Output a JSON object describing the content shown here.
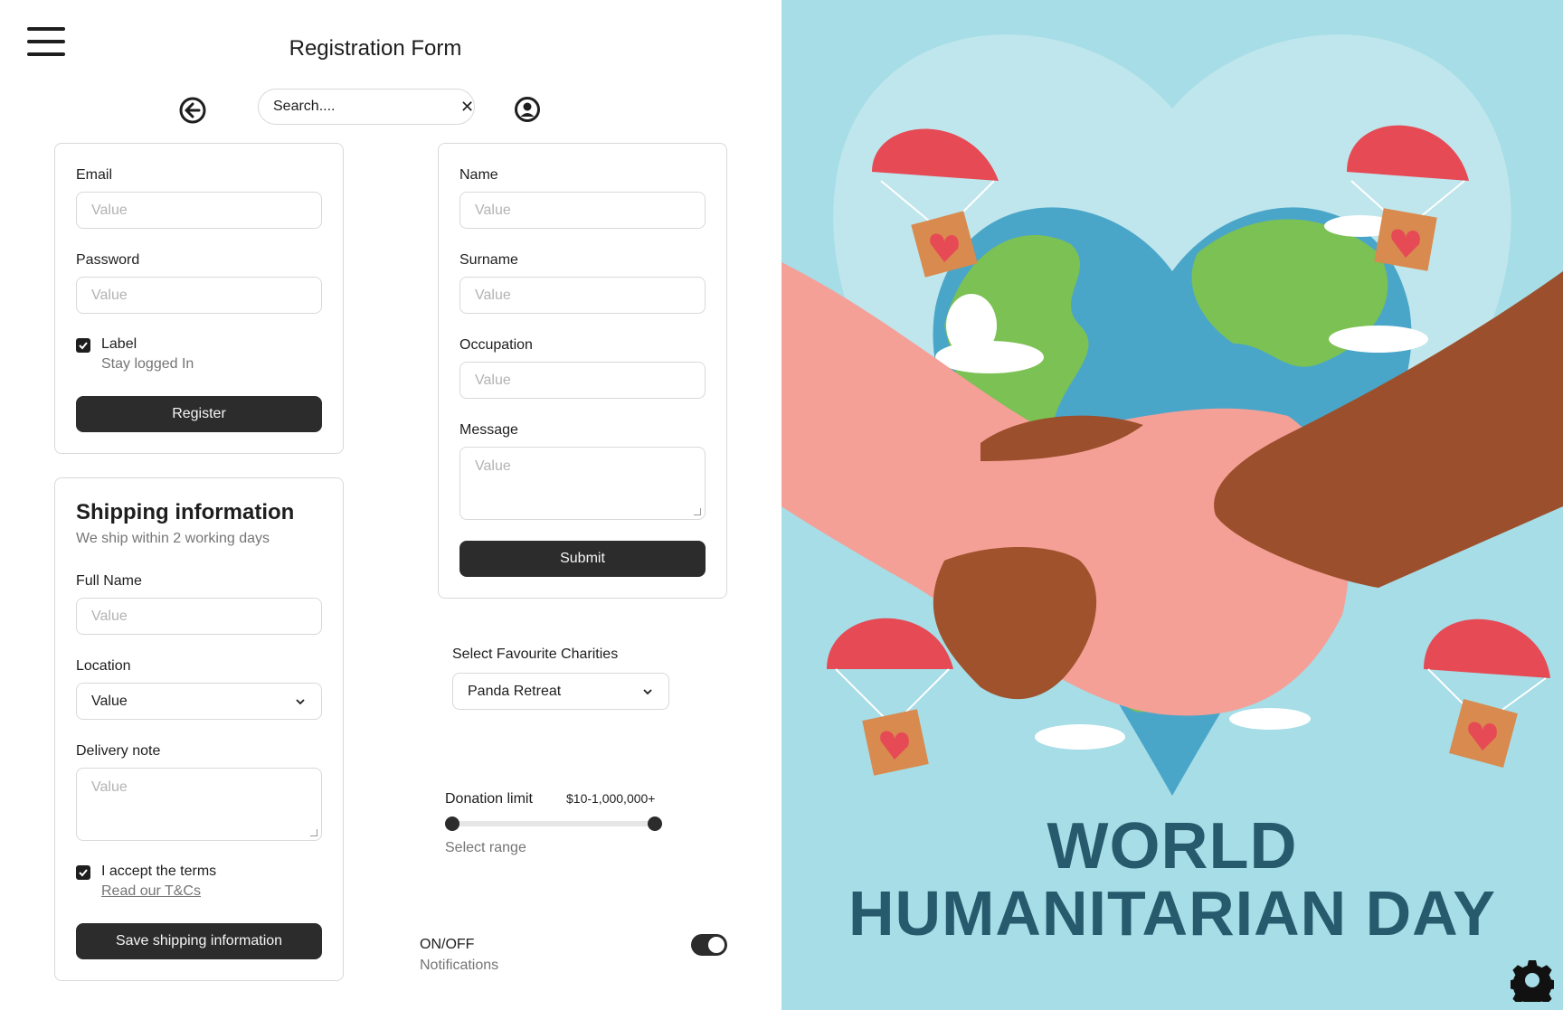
{
  "header": {
    "title": "Registration Form",
    "search_placeholder": "Search....",
    "search_clear": "✕"
  },
  "login_card": {
    "email_label": "Email",
    "email_placeholder": "Value",
    "password_label": "Password",
    "password_placeholder": "Value",
    "checkbox_label": "Label",
    "checkbox_desc": "Stay logged In",
    "checkbox_checked": true,
    "register_label": "Register"
  },
  "shipping_card": {
    "title": "Shipping information",
    "subtitle": "We ship within 2 working days",
    "fullname_label": "Full Name",
    "fullname_placeholder": "Value",
    "location_label": "Location",
    "location_value": "Value",
    "delivery_label": "Delivery note",
    "delivery_placeholder": "Value",
    "terms_label": "I accept the terms",
    "terms_link": "Read our T&Cs",
    "terms_checked": true,
    "save_label": "Save shipping information"
  },
  "profile_card": {
    "name_label": "Name",
    "name_placeholder": "Value",
    "surname_label": "Surname",
    "surname_placeholder": "Value",
    "occupation_label": "Occupation",
    "occupation_placeholder": "Value",
    "message_label": "Message",
    "message_placeholder": "Value",
    "submit_label": "Submit"
  },
  "charities": {
    "label": "Select Favourite Charities",
    "selected": "Panda Retreat"
  },
  "donation": {
    "label": "Donation limit",
    "range_text": "$10-1,000,000+",
    "hint": "Select range",
    "min_fraction": 0,
    "max_fraction": 1
  },
  "notifications": {
    "label": "ON/OFF",
    "desc": "Notifications",
    "on": true
  },
  "poster": {
    "line1": "WORLD",
    "line2": "HUMANITARIAN DAY",
    "colors": {
      "background": "#a6dde6",
      "heart_light": "#bfe6ec",
      "ocean": "#4aa6c9",
      "land": "#7cc153",
      "text": "#265a6c",
      "parachute": "#e64a55",
      "box": "#d98a4f",
      "hand_light": "#f4a097",
      "hand_dark": "#9c4f2c"
    }
  }
}
